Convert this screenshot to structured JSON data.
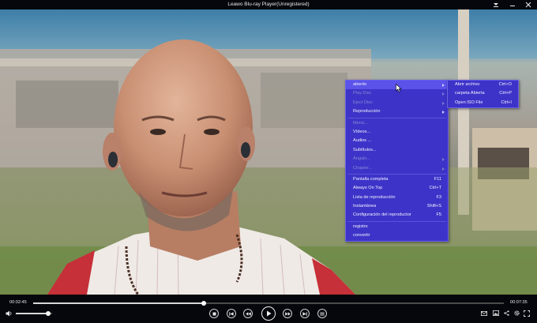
{
  "window": {
    "title": "Leawo Blu-ray Player(Unregistered)"
  },
  "main_menu": {
    "items": [
      {
        "label": "abierto",
        "shortcut": "",
        "submenu": true,
        "disabled": false,
        "highlighted": true
      },
      {
        "label": "Play Disc",
        "shortcut": "",
        "submenu": true,
        "disabled": true,
        "highlighted": false
      },
      {
        "label": "Eject Disc",
        "shortcut": "",
        "submenu": true,
        "disabled": true,
        "highlighted": false
      },
      {
        "label": "Reproducción",
        "shortcut": "",
        "submenu": true,
        "disabled": false,
        "highlighted": false
      },
      {
        "label": "Menú...",
        "shortcut": "",
        "submenu": false,
        "disabled": true,
        "highlighted": false
      },
      {
        "label": "Vídeos...",
        "shortcut": "",
        "submenu": false,
        "disabled": false,
        "highlighted": false
      },
      {
        "label": "Audios ...",
        "shortcut": "",
        "submenu": false,
        "disabled": false,
        "highlighted": false
      },
      {
        "label": "Subtítulos...",
        "shortcut": "",
        "submenu": false,
        "disabled": false,
        "highlighted": false
      },
      {
        "label": "Ángulo...",
        "shortcut": "",
        "submenu": true,
        "disabled": true,
        "highlighted": false
      },
      {
        "label": "Chapter...",
        "shortcut": "",
        "submenu": true,
        "disabled": true,
        "highlighted": false
      },
      {
        "label": "Pantalla completa",
        "shortcut": "F11",
        "submenu": false,
        "disabled": false,
        "highlighted": false
      },
      {
        "label": "Always On Top",
        "shortcut": "Ctrl+T",
        "submenu": false,
        "disabled": false,
        "highlighted": false
      },
      {
        "label": "Lista de reproducción",
        "shortcut": "F3",
        "submenu": false,
        "disabled": false,
        "highlighted": false
      },
      {
        "label": "Instantánea",
        "shortcut": "Shift+S",
        "submenu": false,
        "disabled": false,
        "highlighted": false
      },
      {
        "label": "Configuración del reproductor",
        "shortcut": "F5",
        "submenu": false,
        "disabled": false,
        "highlighted": false
      },
      {
        "label": "registro",
        "shortcut": "",
        "submenu": false,
        "disabled": false,
        "highlighted": false
      },
      {
        "label": "convertir",
        "shortcut": "",
        "submenu": false,
        "disabled": false,
        "highlighted": false
      }
    ]
  },
  "open_submenu": {
    "items": [
      {
        "label": "Abrir archivo",
        "shortcut": "Ctrl+O"
      },
      {
        "label": "carpeta Abierta",
        "shortcut": "Ctrl+P"
      },
      {
        "label": "Open ISO File",
        "shortcut": "Ctrl+I"
      }
    ]
  },
  "player": {
    "elapsed": "00:02:45",
    "duration": "00:07:35",
    "progress": 0.363,
    "volume": 0.9
  },
  "colors": {
    "menu_bg": "#3d33c8",
    "menu_highlight": "#5b52ea",
    "control_bar": "#06070d"
  },
  "icons": [
    "menu-icon",
    "minimize-icon",
    "close-icon",
    "stop-icon",
    "skip-back-icon",
    "rewind-icon",
    "play-icon",
    "fast-forward-icon",
    "skip-forward-icon",
    "playlist-icon",
    "mail-icon",
    "screenshot-icon",
    "share-icon",
    "settings-icon",
    "fullscreen-icon"
  ]
}
